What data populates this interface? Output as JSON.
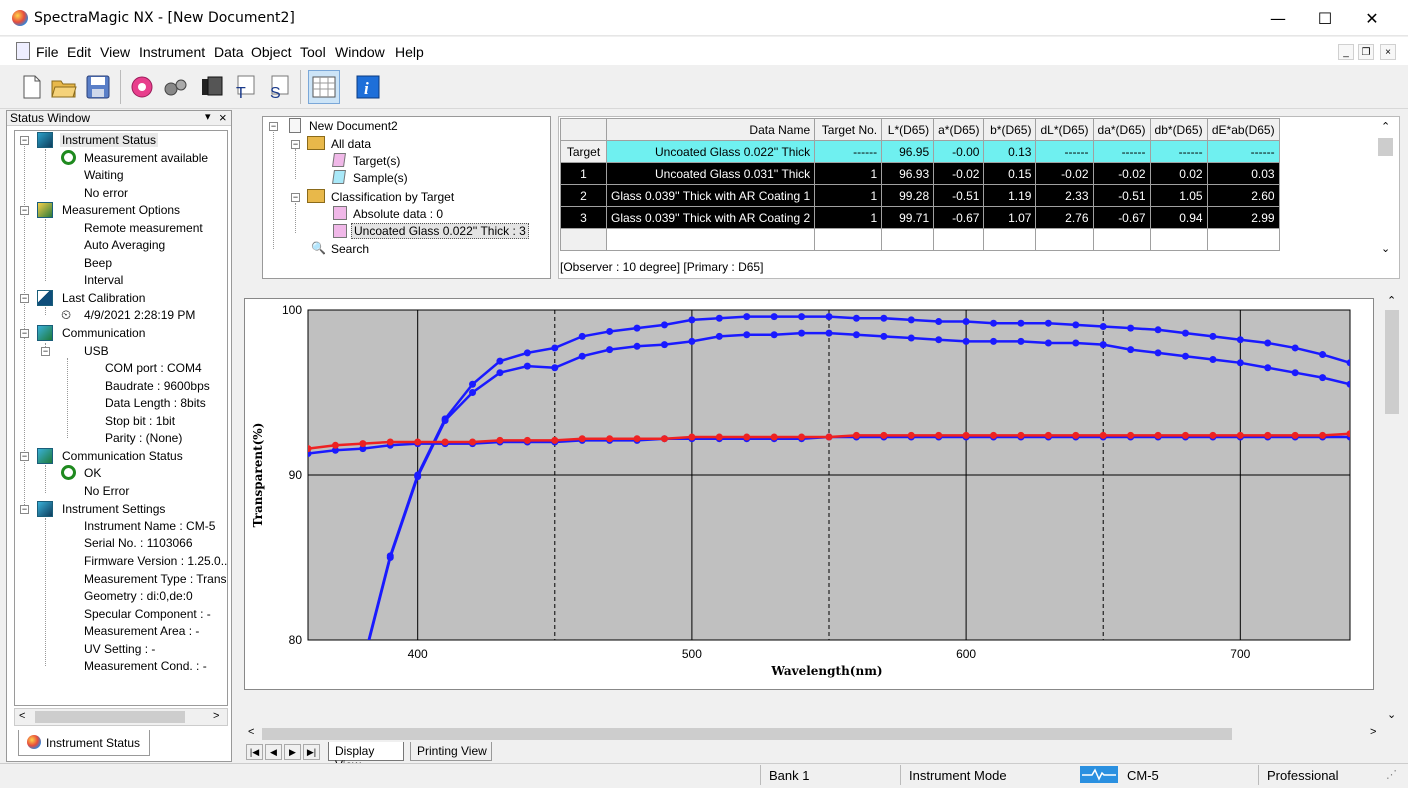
{
  "window": {
    "title": "SpectraMagic NX - [New Document2]",
    "minimize": "—",
    "maximize": "☐",
    "close": "✕"
  },
  "menu": {
    "items": [
      "File",
      "Edit",
      "View",
      "Instrument",
      "Data",
      "Object",
      "Tool",
      "Window",
      "Help"
    ],
    "mdi_min": "_",
    "mdi_restore": "❐",
    "mdi_close": "×"
  },
  "toolbar": {
    "icons": [
      "new-document-icon",
      "open-folder-icon",
      "save-disk-icon",
      "measure-target-icon",
      "instrument-settings-icon",
      "paste-icon",
      "target-icon",
      "sample-icon",
      "grid-view-icon",
      "info-icon"
    ]
  },
  "status_window": {
    "title": "Status Window",
    "pin": "▾",
    "close": "×",
    "tab_label": "Instrument Status",
    "sections": {
      "instrument_status": {
        "label": "Instrument Status",
        "items": [
          "Measurement available",
          "Waiting",
          "No error"
        ]
      },
      "measurement_options": {
        "label": "Measurement Options",
        "items": [
          "Remote measurement",
          "Auto Averaging",
          "Beep",
          "Interval"
        ]
      },
      "last_calibration": {
        "label": "Last Calibration",
        "value": "4/9/2021 2:28:19 PM"
      },
      "communication": {
        "label": "Communication",
        "usb": "USB",
        "items": [
          "COM port : COM4",
          "Baudrate : 9600bps",
          "Data Length : 8bits",
          "Stop bit : 1bit",
          "Parity : (None)"
        ]
      },
      "communication_status": {
        "label": "Communication Status",
        "items": [
          "OK",
          "No Error"
        ]
      },
      "instrument_settings": {
        "label": "Instrument Settings",
        "items": [
          "Instrument Name : CM-5",
          "Serial No. : 1103066",
          "Firmware Version : 1.25.0...",
          "Measurement Type : Transı",
          "Geometry : di:0,de:0",
          "Specular Component : -",
          "Measurement Area : -",
          "UV Setting : -",
          "Measurement Cond. : -"
        ]
      }
    }
  },
  "doc_tree": {
    "root": "New Document2",
    "all_data": "All data",
    "targets": "Target(s)",
    "samples": "Sample(s)",
    "classification": "Classification by Target",
    "absolute": "Absolute data : 0",
    "uncoated": "Uncoated Glass 0.022'' Thick  : 3",
    "search": "Search"
  },
  "grid": {
    "headers": [
      "Data Name",
      "Target No.",
      "L*(D65)",
      "a*(D65)",
      "b*(D65)",
      "dL*(D65)",
      "da*(D65)",
      "db*(D65)",
      "dE*ab(D65)"
    ],
    "rows": [
      {
        "head": "Target",
        "cells": [
          "Uncoated Glass 0.022'' Thick",
          "------",
          "96.95",
          "-0.00",
          "0.13",
          "------",
          "------",
          "------",
          "------"
        ]
      },
      {
        "head": "1",
        "cells": [
          "Uncoated Glass 0.031'' Thick",
          "1",
          "96.93",
          "-0.02",
          "0.15",
          "-0.02",
          "-0.02",
          "0.02",
          "0.03"
        ]
      },
      {
        "head": "2",
        "cells": [
          "Glass 0.039'' Thick with AR Coating 1",
          "1",
          "99.28",
          "-0.51",
          "1.19",
          "2.33",
          "-0.51",
          "1.05",
          "2.60"
        ]
      },
      {
        "head": "3",
        "cells": [
          "Glass 0.039'' Thick with AR Coating 2",
          "1",
          "99.71",
          "-0.67",
          "1.07",
          "2.76",
          "-0.67",
          "0.94",
          "2.99"
        ]
      }
    ],
    "note": "[Observer : 10 degree]  [Primary : D65]"
  },
  "chart_data": {
    "type": "line",
    "xlabel": "Wavelength(nm)",
    "ylabel": "Transparent(%)",
    "xlim": [
      360,
      740
    ],
    "ylim": [
      80,
      100
    ],
    "xticks": [
      400,
      500,
      600,
      700
    ],
    "yticks": [
      80,
      90,
      100
    ],
    "grid": true,
    "x": [
      360,
      370,
      380,
      390,
      400,
      410,
      420,
      430,
      440,
      450,
      460,
      470,
      480,
      490,
      500,
      510,
      520,
      530,
      540,
      550,
      560,
      570,
      580,
      590,
      600,
      610,
      620,
      630,
      640,
      650,
      660,
      670,
      680,
      690,
      700,
      710,
      720,
      730,
      740
    ],
    "series": [
      {
        "color": "#1a1aff",
        "values": [
          null,
          null,
          78.5,
          85.0,
          89.9,
          93.3,
          95.0,
          96.2,
          96.6,
          96.5,
          97.2,
          97.6,
          97.8,
          97.9,
          98.1,
          98.4,
          98.5,
          98.5,
          98.6,
          98.6,
          98.5,
          98.4,
          98.3,
          98.2,
          98.1,
          98.1,
          98.1,
          98.0,
          98.0,
          97.9,
          97.6,
          97.4,
          97.2,
          97.0,
          96.8,
          96.5,
          96.2,
          95.9,
          95.5
        ]
      },
      {
        "color": "#1a1aff",
        "values": [
          null,
          null,
          78.6,
          85.1,
          90.0,
          93.4,
          95.5,
          96.9,
          97.4,
          97.7,
          98.4,
          98.7,
          98.9,
          99.1,
          99.4,
          99.5,
          99.6,
          99.6,
          99.6,
          99.6,
          99.5,
          99.5,
          99.4,
          99.3,
          99.3,
          99.2,
          99.2,
          99.2,
          99.1,
          99.0,
          98.9,
          98.8,
          98.6,
          98.4,
          98.2,
          98.0,
          97.7,
          97.3,
          96.8
        ]
      },
      {
        "color": "#1a1aff",
        "values": [
          91.3,
          91.5,
          91.6,
          91.8,
          91.9,
          91.9,
          91.9,
          92.0,
          92.0,
          92.0,
          92.1,
          92.1,
          92.1,
          92.2,
          92.2,
          92.2,
          92.2,
          92.2,
          92.2,
          92.3,
          92.3,
          92.3,
          92.3,
          92.3,
          92.3,
          92.3,
          92.3,
          92.3,
          92.3,
          92.3,
          92.3,
          92.3,
          92.3,
          92.3,
          92.3,
          92.3,
          92.3,
          92.3,
          92.3
        ]
      },
      {
        "color": "#ee2222",
        "values": [
          91.6,
          91.8,
          91.9,
          92.0,
          92.0,
          92.0,
          92.0,
          92.1,
          92.1,
          92.1,
          92.2,
          92.2,
          92.2,
          92.2,
          92.3,
          92.3,
          92.3,
          92.3,
          92.3,
          92.3,
          92.4,
          92.4,
          92.4,
          92.4,
          92.4,
          92.4,
          92.4,
          92.4,
          92.4,
          92.4,
          92.4,
          92.4,
          92.4,
          92.4,
          92.4,
          92.4,
          92.4,
          92.4,
          92.5
        ]
      }
    ]
  },
  "sheet_tabs": {
    "display": "Display View",
    "printing": "Printing View"
  },
  "statusbar": {
    "bank": "Bank 1",
    "mode": "Instrument Mode",
    "instrument": "CM-5",
    "edition": "Professional"
  }
}
